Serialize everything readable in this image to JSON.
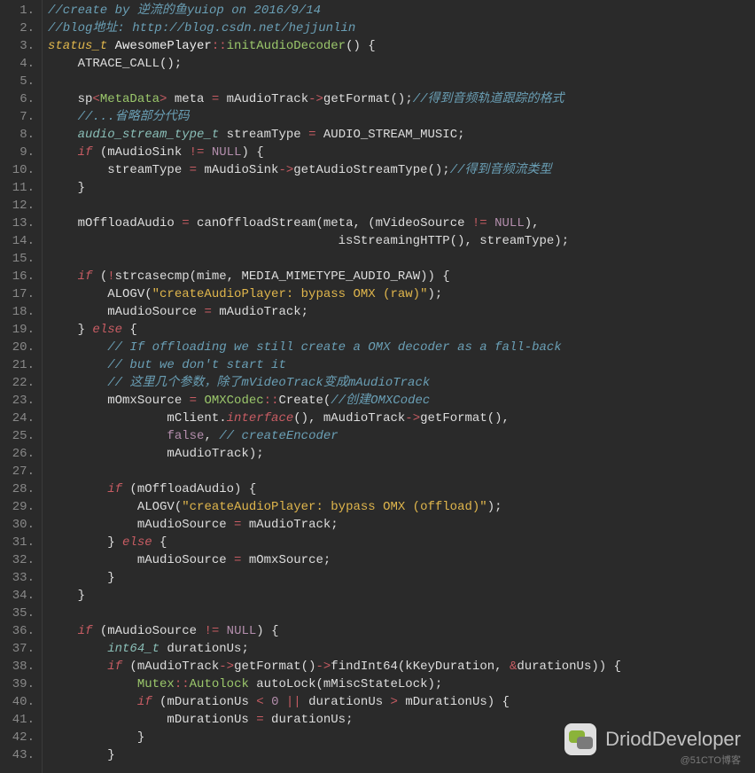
{
  "watermark": {
    "text": "DriodDeveloper",
    "sub": "@51CTO博客"
  },
  "lines": [
    {
      "n": "1.",
      "tokens": [
        {
          "c": "c-comment",
          "t": "//create by 逆流的鱼yuiop on 2016/9/14"
        }
      ]
    },
    {
      "n": "2.",
      "tokens": [
        {
          "c": "c-comment",
          "t": "//blog地址: http://blog.csdn.net/hejjunlin"
        }
      ]
    },
    {
      "n": "3.",
      "tokens": [
        {
          "c": "c-type",
          "t": "status_t"
        },
        {
          "c": "c-white",
          "t": " AwesomePlayer"
        },
        {
          "c": "c-op",
          "t": "::"
        },
        {
          "c": "c-func",
          "t": "initAudioDecoder"
        },
        {
          "c": "c-paren",
          "t": "() {"
        }
      ]
    },
    {
      "n": "4.",
      "tokens": [
        {
          "c": "c-ident",
          "t": "    ATRACE_CALL();"
        }
      ]
    },
    {
      "n": "5.",
      "tokens": []
    },
    {
      "n": "6.",
      "tokens": [
        {
          "c": "c-ident",
          "t": "    sp"
        },
        {
          "c": "c-op",
          "t": "<"
        },
        {
          "c": "c-typegreen",
          "t": "MetaData"
        },
        {
          "c": "c-op",
          "t": ">"
        },
        {
          "c": "c-ident",
          "t": " meta "
        },
        {
          "c": "c-op",
          "t": "="
        },
        {
          "c": "c-ident",
          "t": " mAudioTrack"
        },
        {
          "c": "c-op",
          "t": "->"
        },
        {
          "c": "c-ident",
          "t": "getFormat();"
        },
        {
          "c": "c-comment",
          "t": "//得到音频轨道跟踪的格式"
        }
      ]
    },
    {
      "n": "7.",
      "tokens": [
        {
          "c": "c-ident",
          "t": "    "
        },
        {
          "c": "c-comment",
          "t": "//...省略部分代码"
        }
      ]
    },
    {
      "n": "8.",
      "tokens": [
        {
          "c": "c-ident",
          "t": "    "
        },
        {
          "c": "c-type2",
          "t": "audio_stream_type_t"
        },
        {
          "c": "c-ident",
          "t": " streamType "
        },
        {
          "c": "c-op",
          "t": "="
        },
        {
          "c": "c-ident",
          "t": " AUDIO_STREAM_MUSIC;"
        }
      ]
    },
    {
      "n": "9.",
      "tokens": [
        {
          "c": "c-ident",
          "t": "    "
        },
        {
          "c": "c-keyword",
          "t": "if"
        },
        {
          "c": "c-ident",
          "t": " (mAudioSink "
        },
        {
          "c": "c-op",
          "t": "!="
        },
        {
          "c": "c-ident",
          "t": " "
        },
        {
          "c": "c-const",
          "t": "NULL"
        },
        {
          "c": "c-ident",
          "t": ") {"
        }
      ]
    },
    {
      "n": "10.",
      "tokens": [
        {
          "c": "c-ident",
          "t": "        streamType "
        },
        {
          "c": "c-op",
          "t": "="
        },
        {
          "c": "c-ident",
          "t": " mAudioSink"
        },
        {
          "c": "c-op",
          "t": "->"
        },
        {
          "c": "c-ident",
          "t": "getAudioStreamType();"
        },
        {
          "c": "c-comment",
          "t": "//得到音频流类型"
        }
      ]
    },
    {
      "n": "11.",
      "tokens": [
        {
          "c": "c-ident",
          "t": "    }"
        }
      ]
    },
    {
      "n": "12.",
      "tokens": []
    },
    {
      "n": "13.",
      "tokens": [
        {
          "c": "c-ident",
          "t": "    mOffloadAudio "
        },
        {
          "c": "c-op",
          "t": "="
        },
        {
          "c": "c-ident",
          "t": " canOffloadStream(meta, (mVideoSource "
        },
        {
          "c": "c-op",
          "t": "!="
        },
        {
          "c": "c-ident",
          "t": " "
        },
        {
          "c": "c-const",
          "t": "NULL"
        },
        {
          "c": "c-ident",
          "t": "),"
        }
      ]
    },
    {
      "n": "14.",
      "tokens": [
        {
          "c": "c-ident",
          "t": "                                       isStreamingHTTP(), streamType);"
        }
      ]
    },
    {
      "n": "15.",
      "tokens": []
    },
    {
      "n": "16.",
      "tokens": [
        {
          "c": "c-ident",
          "t": "    "
        },
        {
          "c": "c-keyword",
          "t": "if"
        },
        {
          "c": "c-ident",
          "t": " ("
        },
        {
          "c": "c-op",
          "t": "!"
        },
        {
          "c": "c-ident",
          "t": "strcasecmp(mime, MEDIA_MIMETYPE_AUDIO_RAW)) {"
        }
      ]
    },
    {
      "n": "17.",
      "tokens": [
        {
          "c": "c-ident",
          "t": "        ALOGV("
        },
        {
          "c": "c-string",
          "t": "\"createAudioPlayer: bypass OMX (raw)\""
        },
        {
          "c": "c-ident",
          "t": ");"
        }
      ]
    },
    {
      "n": "18.",
      "tokens": [
        {
          "c": "c-ident",
          "t": "        mAudioSource "
        },
        {
          "c": "c-op",
          "t": "="
        },
        {
          "c": "c-ident",
          "t": " mAudioTrack;"
        }
      ]
    },
    {
      "n": "19.",
      "tokens": [
        {
          "c": "c-ident",
          "t": "    } "
        },
        {
          "c": "c-keyword",
          "t": "else"
        },
        {
          "c": "c-ident",
          "t": " {"
        }
      ]
    },
    {
      "n": "20.",
      "tokens": [
        {
          "c": "c-ident",
          "t": "        "
        },
        {
          "c": "c-comment",
          "t": "// If offloading we still create a OMX decoder as a fall-back"
        }
      ]
    },
    {
      "n": "21.",
      "tokens": [
        {
          "c": "c-ident",
          "t": "        "
        },
        {
          "c": "c-comment",
          "t": "// but we don't start it"
        }
      ]
    },
    {
      "n": "22.",
      "tokens": [
        {
          "c": "c-ident",
          "t": "        "
        },
        {
          "c": "c-comment",
          "t": "// 这里几个参数，除了mVideoTrack变成mAudioTrack"
        }
      ]
    },
    {
      "n": "23.",
      "tokens": [
        {
          "c": "c-ident",
          "t": "        mOmxSource "
        },
        {
          "c": "c-op",
          "t": "="
        },
        {
          "c": "c-ident",
          "t": " "
        },
        {
          "c": "c-typegreen",
          "t": "OMXCodec"
        },
        {
          "c": "c-op",
          "t": "::"
        },
        {
          "c": "c-ident",
          "t": "Create("
        },
        {
          "c": "c-comment",
          "t": "//创建OMXCodec"
        }
      ]
    },
    {
      "n": "24.",
      "tokens": [
        {
          "c": "c-ident",
          "t": "                mClient."
        },
        {
          "c": "c-keyword",
          "t": "interface"
        },
        {
          "c": "c-ident",
          "t": "(), mAudioTrack"
        },
        {
          "c": "c-op",
          "t": "->"
        },
        {
          "c": "c-ident",
          "t": "getFormat(),"
        }
      ]
    },
    {
      "n": "25.",
      "tokens": [
        {
          "c": "c-ident",
          "t": "                "
        },
        {
          "c": "c-const",
          "t": "false"
        },
        {
          "c": "c-ident",
          "t": ", "
        },
        {
          "c": "c-comment",
          "t": "// createEncoder"
        }
      ]
    },
    {
      "n": "26.",
      "tokens": [
        {
          "c": "c-ident",
          "t": "                mAudioTrack);"
        }
      ]
    },
    {
      "n": "27.",
      "tokens": []
    },
    {
      "n": "28.",
      "tokens": [
        {
          "c": "c-ident",
          "t": "        "
        },
        {
          "c": "c-keyword",
          "t": "if"
        },
        {
          "c": "c-ident",
          "t": " (mOffloadAudio) {"
        }
      ]
    },
    {
      "n": "29.",
      "tokens": [
        {
          "c": "c-ident",
          "t": "            ALOGV("
        },
        {
          "c": "c-string",
          "t": "\"createAudioPlayer: bypass OMX (offload)\""
        },
        {
          "c": "c-ident",
          "t": ");"
        }
      ]
    },
    {
      "n": "30.",
      "tokens": [
        {
          "c": "c-ident",
          "t": "            mAudioSource "
        },
        {
          "c": "c-op",
          "t": "="
        },
        {
          "c": "c-ident",
          "t": " mAudioTrack;"
        }
      ]
    },
    {
      "n": "31.",
      "tokens": [
        {
          "c": "c-ident",
          "t": "        } "
        },
        {
          "c": "c-keyword",
          "t": "else"
        },
        {
          "c": "c-ident",
          "t": " {"
        }
      ]
    },
    {
      "n": "32.",
      "tokens": [
        {
          "c": "c-ident",
          "t": "            mAudioSource "
        },
        {
          "c": "c-op",
          "t": "="
        },
        {
          "c": "c-ident",
          "t": " mOmxSource;"
        }
      ]
    },
    {
      "n": "33.",
      "tokens": [
        {
          "c": "c-ident",
          "t": "        }"
        }
      ]
    },
    {
      "n": "34.",
      "tokens": [
        {
          "c": "c-ident",
          "t": "    }"
        }
      ]
    },
    {
      "n": "35.",
      "tokens": []
    },
    {
      "n": "36.",
      "tokens": [
        {
          "c": "c-ident",
          "t": "    "
        },
        {
          "c": "c-keyword",
          "t": "if"
        },
        {
          "c": "c-ident",
          "t": " (mAudioSource "
        },
        {
          "c": "c-op",
          "t": "!="
        },
        {
          "c": "c-ident",
          "t": " "
        },
        {
          "c": "c-const",
          "t": "NULL"
        },
        {
          "c": "c-ident",
          "t": ") {"
        }
      ]
    },
    {
      "n": "37.",
      "tokens": [
        {
          "c": "c-ident",
          "t": "        "
        },
        {
          "c": "c-type2",
          "t": "int64_t"
        },
        {
          "c": "c-ident",
          "t": " durationUs;"
        }
      ]
    },
    {
      "n": "38.",
      "tokens": [
        {
          "c": "c-ident",
          "t": "        "
        },
        {
          "c": "c-keyword",
          "t": "if"
        },
        {
          "c": "c-ident",
          "t": " (mAudioTrack"
        },
        {
          "c": "c-op",
          "t": "->"
        },
        {
          "c": "c-ident",
          "t": "getFormat()"
        },
        {
          "c": "c-op",
          "t": "->"
        },
        {
          "c": "c-ident",
          "t": "findInt64(kKeyDuration, "
        },
        {
          "c": "c-op",
          "t": "&"
        },
        {
          "c": "c-ident",
          "t": "durationUs)) {"
        }
      ]
    },
    {
      "n": "39.",
      "tokens": [
        {
          "c": "c-ident",
          "t": "            "
        },
        {
          "c": "c-typegreen",
          "t": "Mutex"
        },
        {
          "c": "c-op",
          "t": "::"
        },
        {
          "c": "c-typegreen",
          "t": "Autolock"
        },
        {
          "c": "c-ident",
          "t": " autoLock(mMiscStateLock);"
        }
      ]
    },
    {
      "n": "40.",
      "tokens": [
        {
          "c": "c-ident",
          "t": "            "
        },
        {
          "c": "c-keyword",
          "t": "if"
        },
        {
          "c": "c-ident",
          "t": " (mDurationUs "
        },
        {
          "c": "c-op",
          "t": "<"
        },
        {
          "c": "c-ident",
          "t": " "
        },
        {
          "c": "c-num",
          "t": "0"
        },
        {
          "c": "c-ident",
          "t": " "
        },
        {
          "c": "c-op",
          "t": "||"
        },
        {
          "c": "c-ident",
          "t": " durationUs "
        },
        {
          "c": "c-op",
          "t": ">"
        },
        {
          "c": "c-ident",
          "t": " mDurationUs) {"
        }
      ]
    },
    {
      "n": "41.",
      "tokens": [
        {
          "c": "c-ident",
          "t": "                mDurationUs "
        },
        {
          "c": "c-op",
          "t": "="
        },
        {
          "c": "c-ident",
          "t": " durationUs;"
        }
      ]
    },
    {
      "n": "42.",
      "tokens": [
        {
          "c": "c-ident",
          "t": "            }"
        }
      ]
    },
    {
      "n": "43.",
      "tokens": [
        {
          "c": "c-ident",
          "t": "        }"
        }
      ]
    }
  ]
}
